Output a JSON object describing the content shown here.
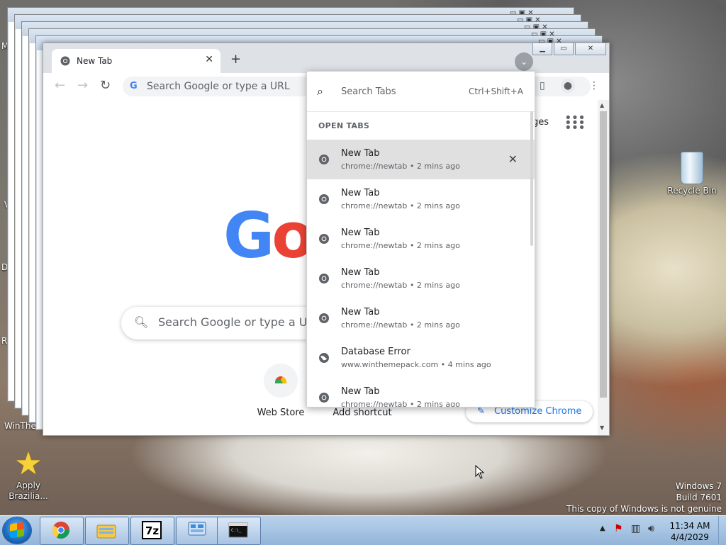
{
  "desktop": {
    "recycle_bin_label": "Recycle Bin",
    "apply_label": "Apply Brazilia...",
    "left_partial_label": "WinTher",
    "watermark": [
      "Windows 7",
      "Build 7601",
      "This copy of Windows is not genuine"
    ]
  },
  "browser": {
    "tab_title": "New Tab",
    "omnibox_placeholder": "Search Google or type a URL",
    "images_link": "ges",
    "logo_text": "Go",
    "search_placeholder": "Search Google or type a URL",
    "shortcuts": [
      {
        "label": "Web Store"
      },
      {
        "label": "Add shortcut"
      }
    ],
    "customize_label": "Customize Chrome"
  },
  "tab_search": {
    "placeholder": "Search Tabs",
    "shortcut_hint": "Ctrl+Shift+A",
    "section_title": "OPEN TABS",
    "tabs": [
      {
        "title": "New Tab",
        "url": "chrome://newtab",
        "age": "2 mins ago",
        "icon": "chrome-icon",
        "active": true
      },
      {
        "title": "New Tab",
        "url": "chrome://newtab",
        "age": "2 mins ago",
        "icon": "chrome-icon"
      },
      {
        "title": "New Tab",
        "url": "chrome://newtab",
        "age": "2 mins ago",
        "icon": "chrome-icon"
      },
      {
        "title": "New Tab",
        "url": "chrome://newtab",
        "age": "2 mins ago",
        "icon": "chrome-icon"
      },
      {
        "title": "New Tab",
        "url": "chrome://newtab",
        "age": "2 mins ago",
        "icon": "chrome-icon"
      },
      {
        "title": "Database Error",
        "url": "www.winthemepack.com",
        "age": "4 mins ago",
        "icon": "globe-icon"
      },
      {
        "title": "New Tab",
        "url": "chrome://newtab",
        "age": "2 mins ago",
        "icon": "chrome-icon"
      }
    ]
  },
  "taskbar": {
    "apps": [
      "chrome-icon",
      "file-explorer-icon",
      "7zip-icon",
      "control-panel-icon",
      "cmd-icon"
    ],
    "time": "11:34 AM",
    "date": "4/4/2029"
  }
}
